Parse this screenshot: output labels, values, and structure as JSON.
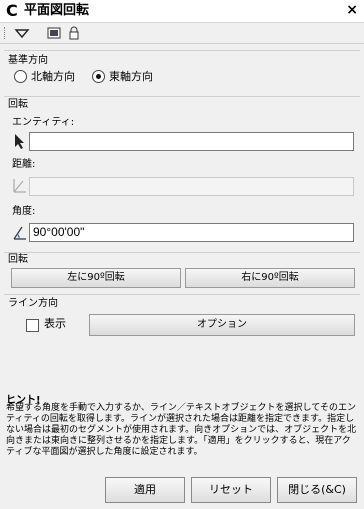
{
  "window": {
    "logo": "C",
    "title": "平面図回転",
    "close": "×"
  },
  "toolbar": {
    "icons": [
      "dropdown-triangle-icon",
      "image-icon",
      "lock-icon"
    ]
  },
  "base_direction": {
    "label": "基準方向",
    "options": [
      "北軸方向",
      "東軸方向"
    ],
    "selected": "東軸方向"
  },
  "rotation": {
    "label": "回転",
    "entity_label": "エンティティ:",
    "entity_value": "",
    "distance_label": "距離:",
    "distance_value": "",
    "angle_label": "角度:",
    "angle_value": "90°00'00\""
  },
  "rotate_buttons": {
    "label": "回転",
    "left": "左に90º回転",
    "right": "右に90º回転"
  },
  "line_direction": {
    "label": "ライン方向",
    "show_label": "表示",
    "show_checked": false,
    "options_button": "オプション"
  },
  "hint": {
    "title": "ヒント!",
    "text": "希望する角度を手動で入力するか、ライン／テキストオブジェクトを選択してそのエンティティの回転を取得します。ラインが選択された場合は距離を指定できます。指定しない場合は最初のセグメントが使用されます。向きオプションでは、オブジェクトを北向きまたは東向きに整列させるかを指定します。「適用」をクリックすると、現在アクティブな平面図が選択した角度に設定されます。"
  },
  "footer": {
    "apply": "適用",
    "reset": "リセット",
    "close": "閉じる(&C)"
  }
}
